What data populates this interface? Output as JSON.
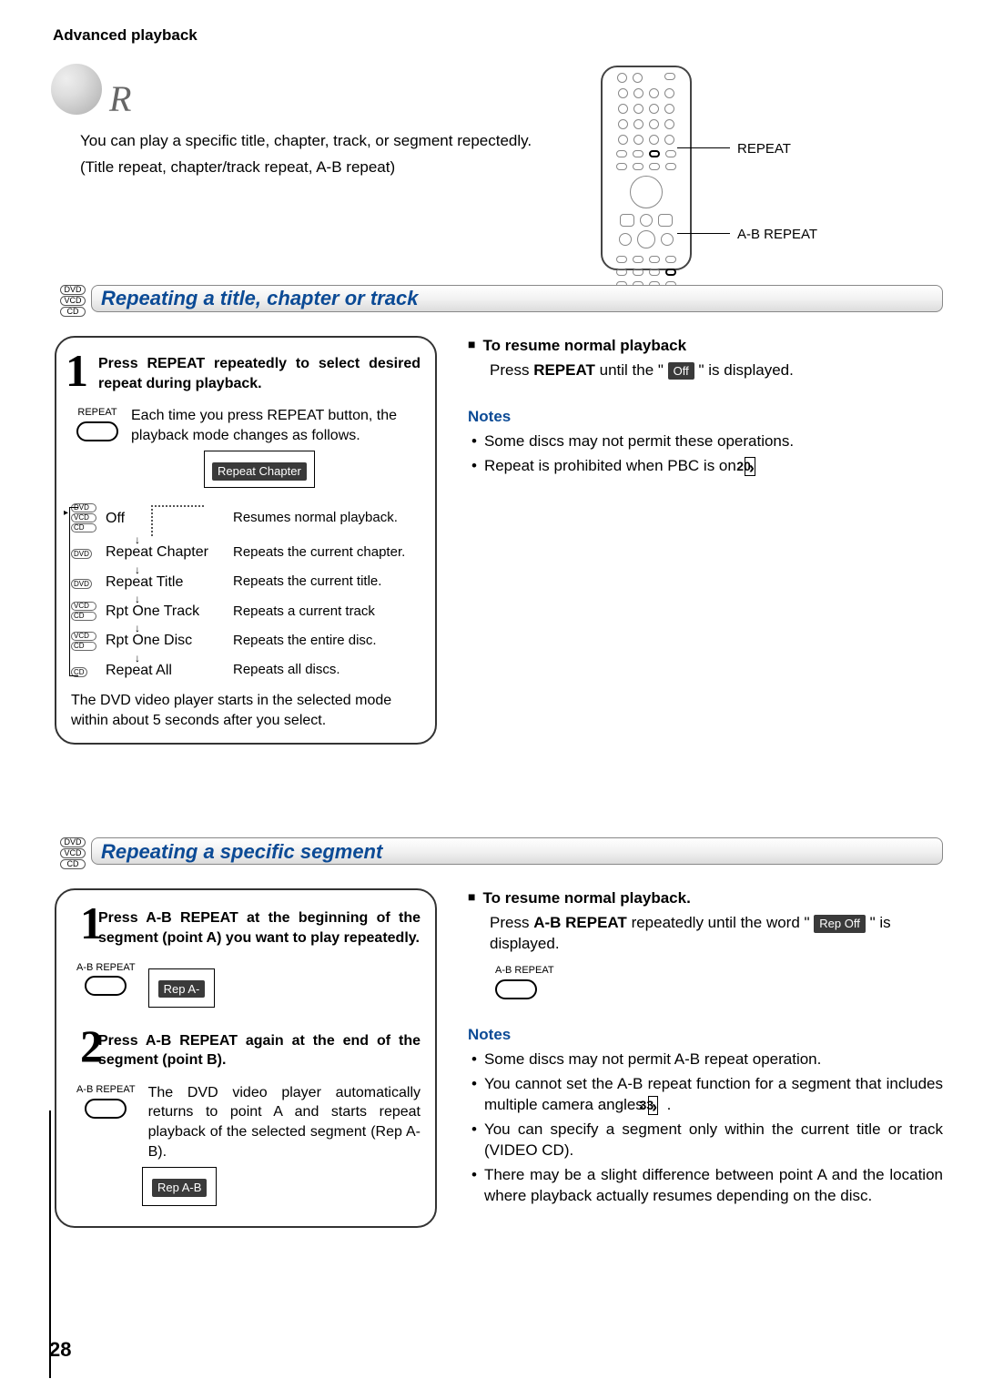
{
  "chapter_title": "Advanced playback",
  "main_title_initial": "R",
  "subtitle1": "You can play a specific title, chapter, track, or segment repectedly.",
  "subtitle2": "(Title repeat, chapter/track repeat, A-B repeat)",
  "remote": {
    "label1": "REPEAT",
    "label2": "A-B REPEAT"
  },
  "section1": {
    "title": "Repeating a title, chapter or track",
    "discs": [
      "DVD",
      "VCD",
      "CD"
    ],
    "step1_heading": "Press REPEAT repeatedly to select desired repeat during playback.",
    "repeat_btn_label": "REPEAT",
    "step1_desc": "Each time you press REPEAT button, the playback mode changes as follows.",
    "osd_indicator": "Repeat Chapter",
    "modes": [
      {
        "tags": [
          "DVD",
          "VCD",
          "CD"
        ],
        "name": "Off",
        "desc": "Resumes normal playback."
      },
      {
        "tags": [
          "DVD"
        ],
        "name": "Repeat Chapter",
        "desc": "Repeats the current chapter."
      },
      {
        "tags": [
          "DVD"
        ],
        "name": "Repeat Title",
        "desc": "Repeats the current title."
      },
      {
        "tags": [
          "VCD",
          "CD"
        ],
        "name": "Rpt One Track",
        "desc": "Repeats a current track"
      },
      {
        "tags": [
          "VCD",
          "CD"
        ],
        "name": "Rpt One Disc",
        "desc": "Repeats the entire disc."
      },
      {
        "tags": [
          "CD"
        ],
        "name": "Repeat All",
        "desc": "Repeats all discs."
      }
    ],
    "footnote": "The DVD video player starts in the selected mode within about 5 seconds after you select.",
    "right": {
      "resume_head": "To resume normal playback",
      "resume_body_a": "Press ",
      "resume_bold": "REPEAT",
      "resume_body_b": " until the \"",
      "pill": "Off",
      "resume_body_c": "\" is displayed.",
      "notes_head": "Notes",
      "notes": [
        "Some discs may not permit these operations.",
        "Repeat is prohibited when PBC is on."
      ],
      "ref1": "20"
    }
  },
  "section2": {
    "title": "Repeating a specific segment",
    "discs": [
      "DVD",
      "VCD",
      "CD"
    ],
    "step1_heading": "Press A-B REPEAT at the beginning of the segment (point A) you want to play repeatedly.",
    "ab_btn_label": "A-B REPEAT",
    "step1_osd": "Rep A-",
    "step2_heading": "Press A-B REPEAT again at the end of the segment (point B).",
    "step2_body": "The DVD video player automatically returns to point A and starts repeat playback of the selected segment (Rep A-B).",
    "step2_osd": "Rep A-B",
    "right": {
      "resume_head": "To resume normal playback.",
      "resume_body_a": "Press ",
      "resume_bold": "A-B REPEAT",
      "resume_body_b": " repeatedly until the word \"",
      "pill": "Rep Off",
      "resume_body_c": "\" is displayed.",
      "ab_btn_label": "A-B REPEAT",
      "notes_head": "Notes",
      "notes": [
        "Some discs may not permit A-B repeat operation.",
        "You cannot set the A-B repeat function for a segment that includes multiple camera angles",
        "You can specify a segment only within the current title or track (VIDEO CD).",
        "There may be a slight difference between point A and the location where playback actually resumes depending on the disc."
      ],
      "ref1": "33"
    }
  },
  "page_number": "28"
}
